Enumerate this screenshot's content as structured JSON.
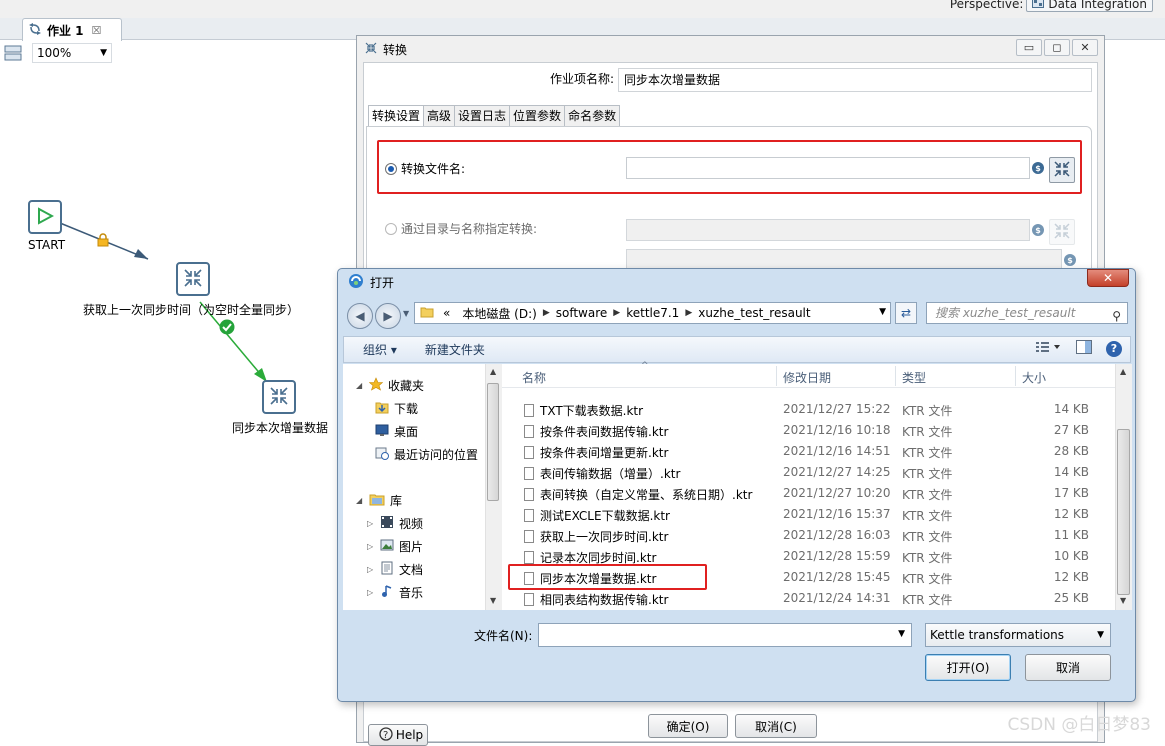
{
  "perspective": {
    "label": "Perspective:",
    "button": "Data Integration"
  },
  "job_tab": {
    "label": "作业 1",
    "close": "☒"
  },
  "zoom": {
    "value": "100%"
  },
  "canvas": {
    "nodes": [
      {
        "label": "START"
      },
      {
        "label": "获取上一次同步时间（为空时全量同步）"
      },
      {
        "label": "同步本次增量数据"
      }
    ]
  },
  "trans_dialog": {
    "title": "转换",
    "jobname_label": "作业项名称:",
    "jobname_value": "同步本次增量数据",
    "tabs": [
      "转换设置",
      "高级",
      "设置日志",
      "位置参数",
      "命名参数"
    ],
    "radio1_label": "转换文件名:",
    "radio2_label": "通过目录与名称指定转换:",
    "ok": "确定(O)",
    "cancel": "取消(C)",
    "help": "Help",
    "win_buttons": [
      "▭",
      "◻",
      "✕"
    ]
  },
  "open_dialog": {
    "title": "打开",
    "close": "✕",
    "address": {
      "prefix": "«",
      "segments": [
        "本地磁盘 (D:)",
        "software",
        "kettle7.1",
        "xuzhe_test_resault"
      ]
    },
    "search_placeholder": "搜索 xuzhe_test_resault",
    "organize": "组织 ▾",
    "new_folder": "新建文件夹",
    "nav": [
      {
        "label": "收藏夹",
        "icon": "star-icon"
      },
      {
        "label": "下载",
        "icon": "download-folder-icon"
      },
      {
        "label": "桌面",
        "icon": "desktop-icon"
      },
      {
        "label": "最近访问的位置",
        "icon": "recent-places-icon"
      },
      {
        "label": "库",
        "icon": "library-icon"
      },
      {
        "label": "视频",
        "icon": "video-icon"
      },
      {
        "label": "图片",
        "icon": "picture-icon"
      },
      {
        "label": "文档",
        "icon": "document-icon"
      },
      {
        "label": "音乐",
        "icon": "music-icon"
      }
    ],
    "columns": {
      "name": "名称",
      "date": "修改日期",
      "type": "类型",
      "size": "大小"
    },
    "files": [
      {
        "name": "TXT下载表数据.ktr",
        "date": "2021/12/27 15:22",
        "type": "KTR 文件",
        "size": "14 KB"
      },
      {
        "name": "按条件表间数据传输.ktr",
        "date": "2021/12/16 10:18",
        "type": "KTR 文件",
        "size": "27 KB"
      },
      {
        "name": "按条件表间增量更新.ktr",
        "date": "2021/12/16 14:51",
        "type": "KTR 文件",
        "size": "28 KB"
      },
      {
        "name": "表间传输数据（增量）.ktr",
        "date": "2021/12/27 14:25",
        "type": "KTR 文件",
        "size": "14 KB"
      },
      {
        "name": "表间转换（自定义常量、系统日期）.ktr",
        "date": "2021/12/27 10:20",
        "type": "KTR 文件",
        "size": "17 KB"
      },
      {
        "name": "测试EXCLE下载数据.ktr",
        "date": "2021/12/16 15:37",
        "type": "KTR 文件",
        "size": "12 KB"
      },
      {
        "name": "获取上一次同步时间.ktr",
        "date": "2021/12/28 16:03",
        "type": "KTR 文件",
        "size": "11 KB"
      },
      {
        "name": "记录本次同步时间.ktr",
        "date": "2021/12/28 15:59",
        "type": "KTR 文件",
        "size": "10 KB"
      },
      {
        "name": "同步本次增量数据.ktr",
        "date": "2021/12/28 15:45",
        "type": "KTR 文件",
        "size": "12 KB"
      },
      {
        "name": "相同表结构数据传输.ktr",
        "date": "2021/12/24 14:31",
        "type": "KTR 文件",
        "size": "25 KB"
      }
    ],
    "filename_label": "文件名(N):",
    "filename_value": "",
    "filetype": "Kettle transformations",
    "open": "打开(O)",
    "cancel": "取消"
  },
  "watermark": "CSDN @白日梦83",
  "colors": {
    "highlight_red": "#e02020",
    "node_border": "#4a6f8f",
    "start_green": "#2fa84f"
  }
}
